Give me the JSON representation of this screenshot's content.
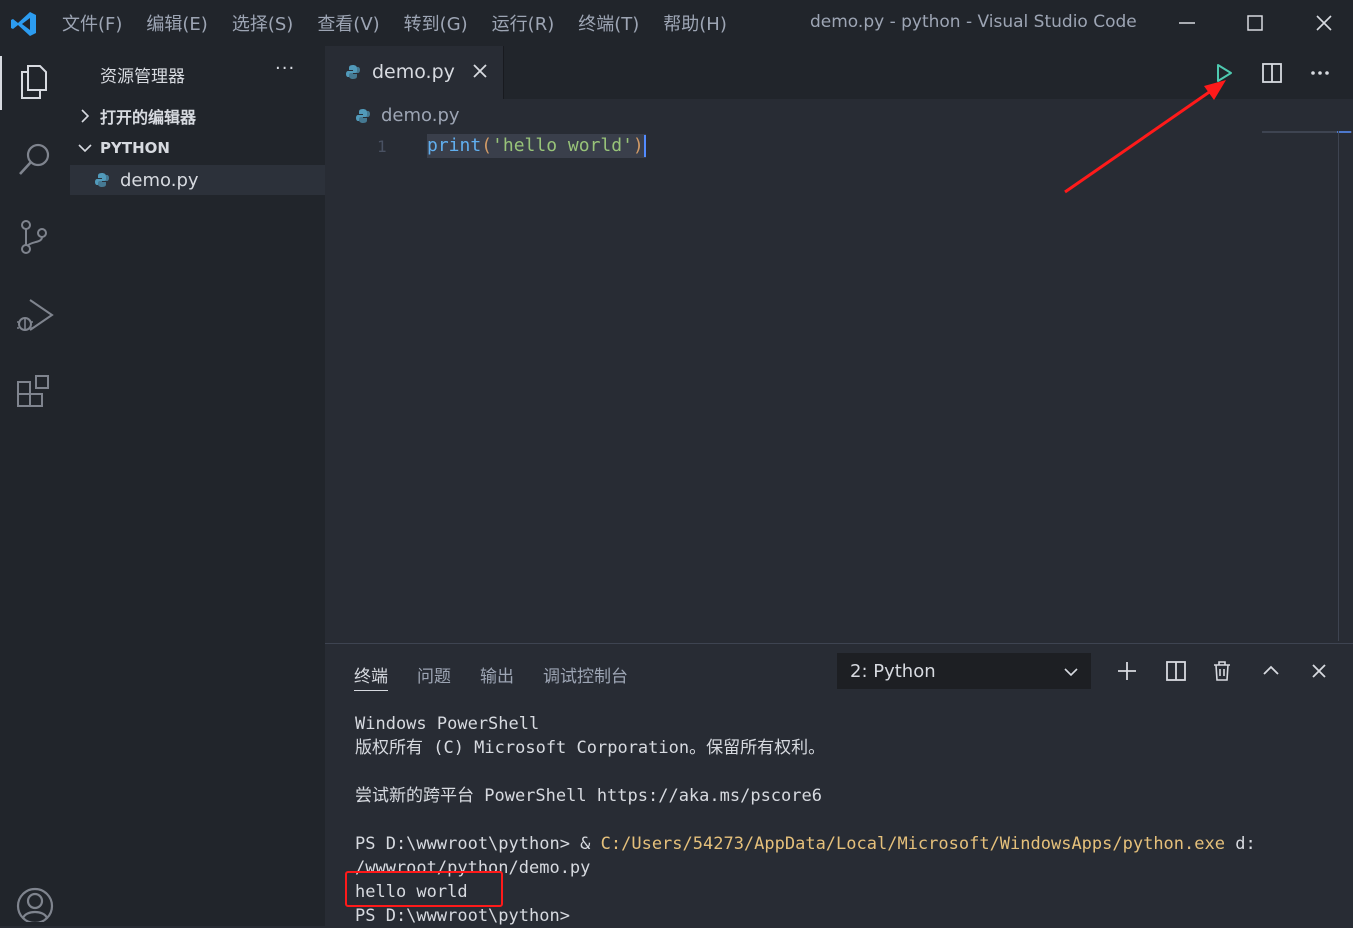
{
  "window": {
    "title": "demo.py - python - Visual Studio Code",
    "menu": [
      "文件(F)",
      "编辑(E)",
      "选择(S)",
      "查看(V)",
      "转到(G)",
      "运行(R)",
      "终端(T)",
      "帮助(H)"
    ]
  },
  "activity_bar": {
    "icons": [
      "explorer-icon",
      "search-icon",
      "source-control-icon",
      "run-debug-icon",
      "extensions-icon",
      "account-icon"
    ]
  },
  "sidebar": {
    "title": "资源管理器",
    "more": "···",
    "sections": [
      {
        "label": "打开的编辑器",
        "expanded": false
      },
      {
        "label": "PYTHON",
        "expanded": true
      }
    ],
    "files": [
      {
        "name": "demo.py",
        "selected": true
      }
    ]
  },
  "editor": {
    "tab": {
      "label": "demo.py"
    },
    "breadcrumb": "demo.py",
    "line_number": "1",
    "code": {
      "fn": "print",
      "open": "(",
      "str": "'hello world'",
      "close": ")"
    }
  },
  "panel": {
    "tabs": [
      "终端",
      "问题",
      "输出",
      "调试控制台"
    ],
    "active_tab": "终端",
    "terminal_select": "2: Python",
    "terminal_lines": [
      "Windows PowerShell",
      "版权所有 (C) Microsoft Corporation。保留所有权利。",
      "",
      "尝试新的跨平台 PowerShell https://aka.ms/pscore6",
      ""
    ],
    "command_prompt": "PS D:\\wwwroot\\python> & ",
    "command_path": "C:/Users/54273/AppData/Local/Microsoft/WindowsApps/python.exe",
    "command_arg": " d:",
    "command_wrap": "/wwwroot/python/demo.py",
    "output": "hello world",
    "final_prompt": "PS D:\\wwwroot\\python>"
  },
  "colors": {
    "run_button": "#4ec9b0",
    "annotation": "#ff1a1a",
    "accent": "#528bff"
  }
}
